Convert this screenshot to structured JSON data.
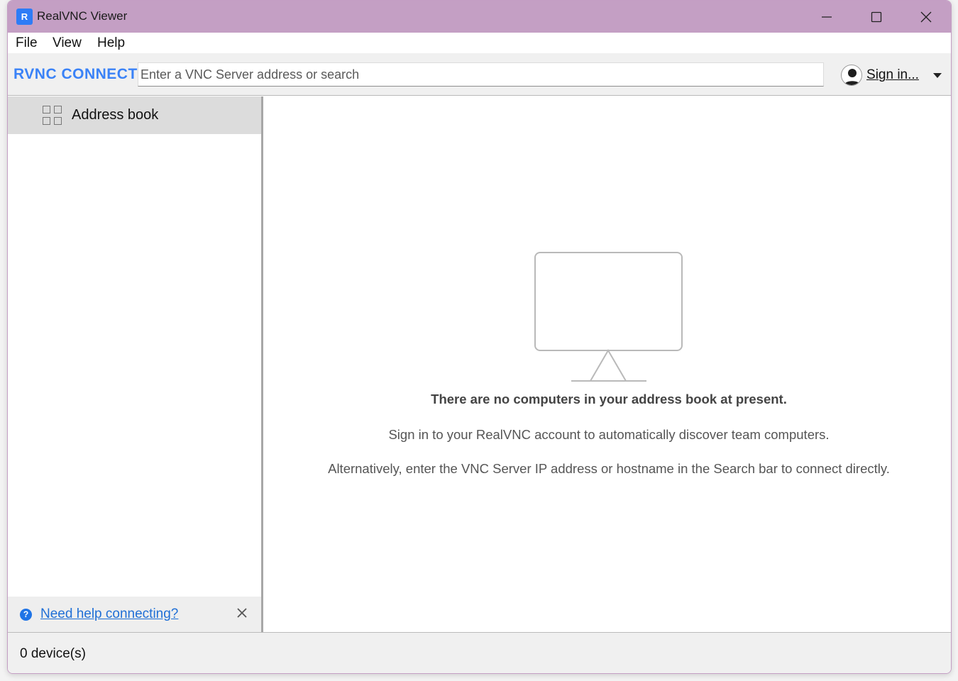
{
  "window": {
    "title": "RealVNC Viewer",
    "app_icon_text": "R"
  },
  "menu": {
    "file": "File",
    "view": "View",
    "help": "Help"
  },
  "toolbar": {
    "logo": "RVNC CONNECT",
    "search_placeholder": "Enter a VNC Server address or search",
    "signin_label": "Sign in..."
  },
  "sidebar": {
    "items": [
      {
        "label": "Address book",
        "icon": "grid-icon",
        "selected": true
      }
    ],
    "help_link": "Need help connecting?"
  },
  "main": {
    "empty_heading": "There are no computers in your address book at present.",
    "empty_line1": "Sign in to your RealVNC account to automatically discover team computers.",
    "empty_line2": "Alternatively, enter the VNC Server IP address or hostname in the Search bar to connect directly."
  },
  "status": {
    "device_count": "0 device(s)"
  },
  "colors": {
    "titlebar": "#c49fc4",
    "accent": "#3a82f7",
    "link": "#1f6fd6"
  }
}
